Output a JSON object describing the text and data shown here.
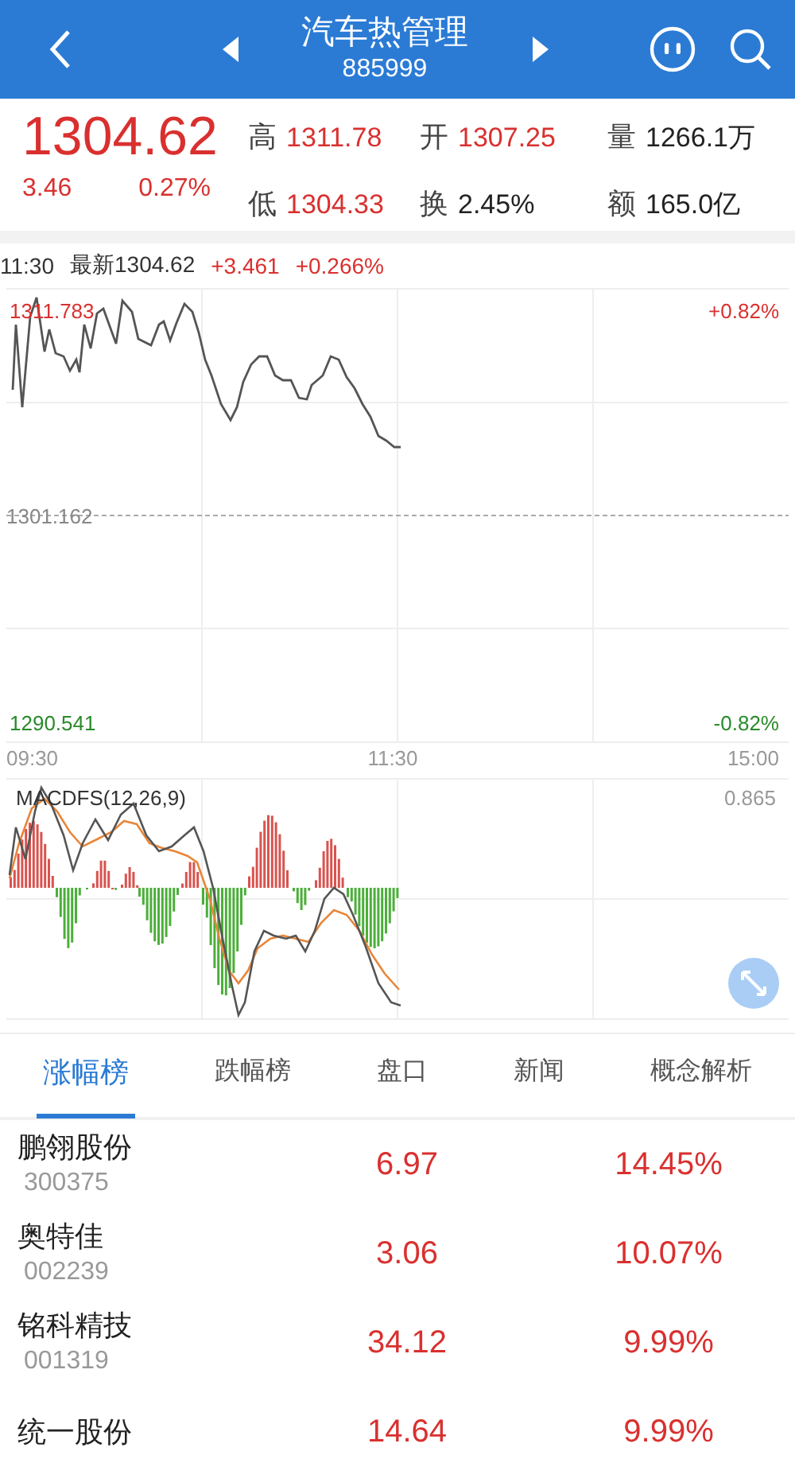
{
  "header": {
    "title": "汽车热管理",
    "code": "885999"
  },
  "quote": {
    "price": "1304.62",
    "change": "3.46",
    "change_pct": "0.27%",
    "stats": [
      {
        "label": "高",
        "value": "1311.78",
        "color": "#d9302f"
      },
      {
        "label": "开",
        "value": "1307.25",
        "color": "#d9302f"
      },
      {
        "label": "量",
        "value": "1266.1万",
        "color": "#222222"
      },
      {
        "label": "低",
        "value": "1304.33",
        "color": "#d9302f"
      },
      {
        "label": "换",
        "value": "2.45%",
        "color": "#222222"
      },
      {
        "label": "额",
        "value": "165.0亿",
        "color": "#222222"
      }
    ]
  },
  "chart": {
    "time": "11:30",
    "latest": "最新1304.62",
    "change": "+3.461",
    "change_pct": "+0.266%",
    "high_price": "1311.783",
    "high_pct": "+0.82%",
    "base_price": "1301.162",
    "low_price": "1290.541",
    "low_pct": "-0.82%",
    "times": [
      "09:30",
      "11:30",
      "15:00"
    ]
  },
  "macd": {
    "title": "MACDFS(12,26,9)",
    "value": "0.865"
  },
  "tabs": [
    {
      "label": "涨幅榜",
      "selected": true
    },
    {
      "label": "跌幅榜",
      "selected": false
    },
    {
      "label": "盘口",
      "selected": false
    },
    {
      "label": "新闻",
      "selected": false
    },
    {
      "label": "概念解析",
      "selected": false
    }
  ],
  "stocks": [
    {
      "name": "鹏翎股份",
      "code": "300375",
      "price": "6.97",
      "change_pct": "14.45%"
    },
    {
      "name": "奥特佳",
      "code": "002239",
      "price": "3.06",
      "change_pct": "10.07%"
    },
    {
      "name": "铭科精技",
      "code": "001319",
      "price": "34.12",
      "change_pct": "9.99%"
    },
    {
      "name": "统一股份",
      "price": "14.64",
      "change_pct": "9.99%"
    }
  ]
}
